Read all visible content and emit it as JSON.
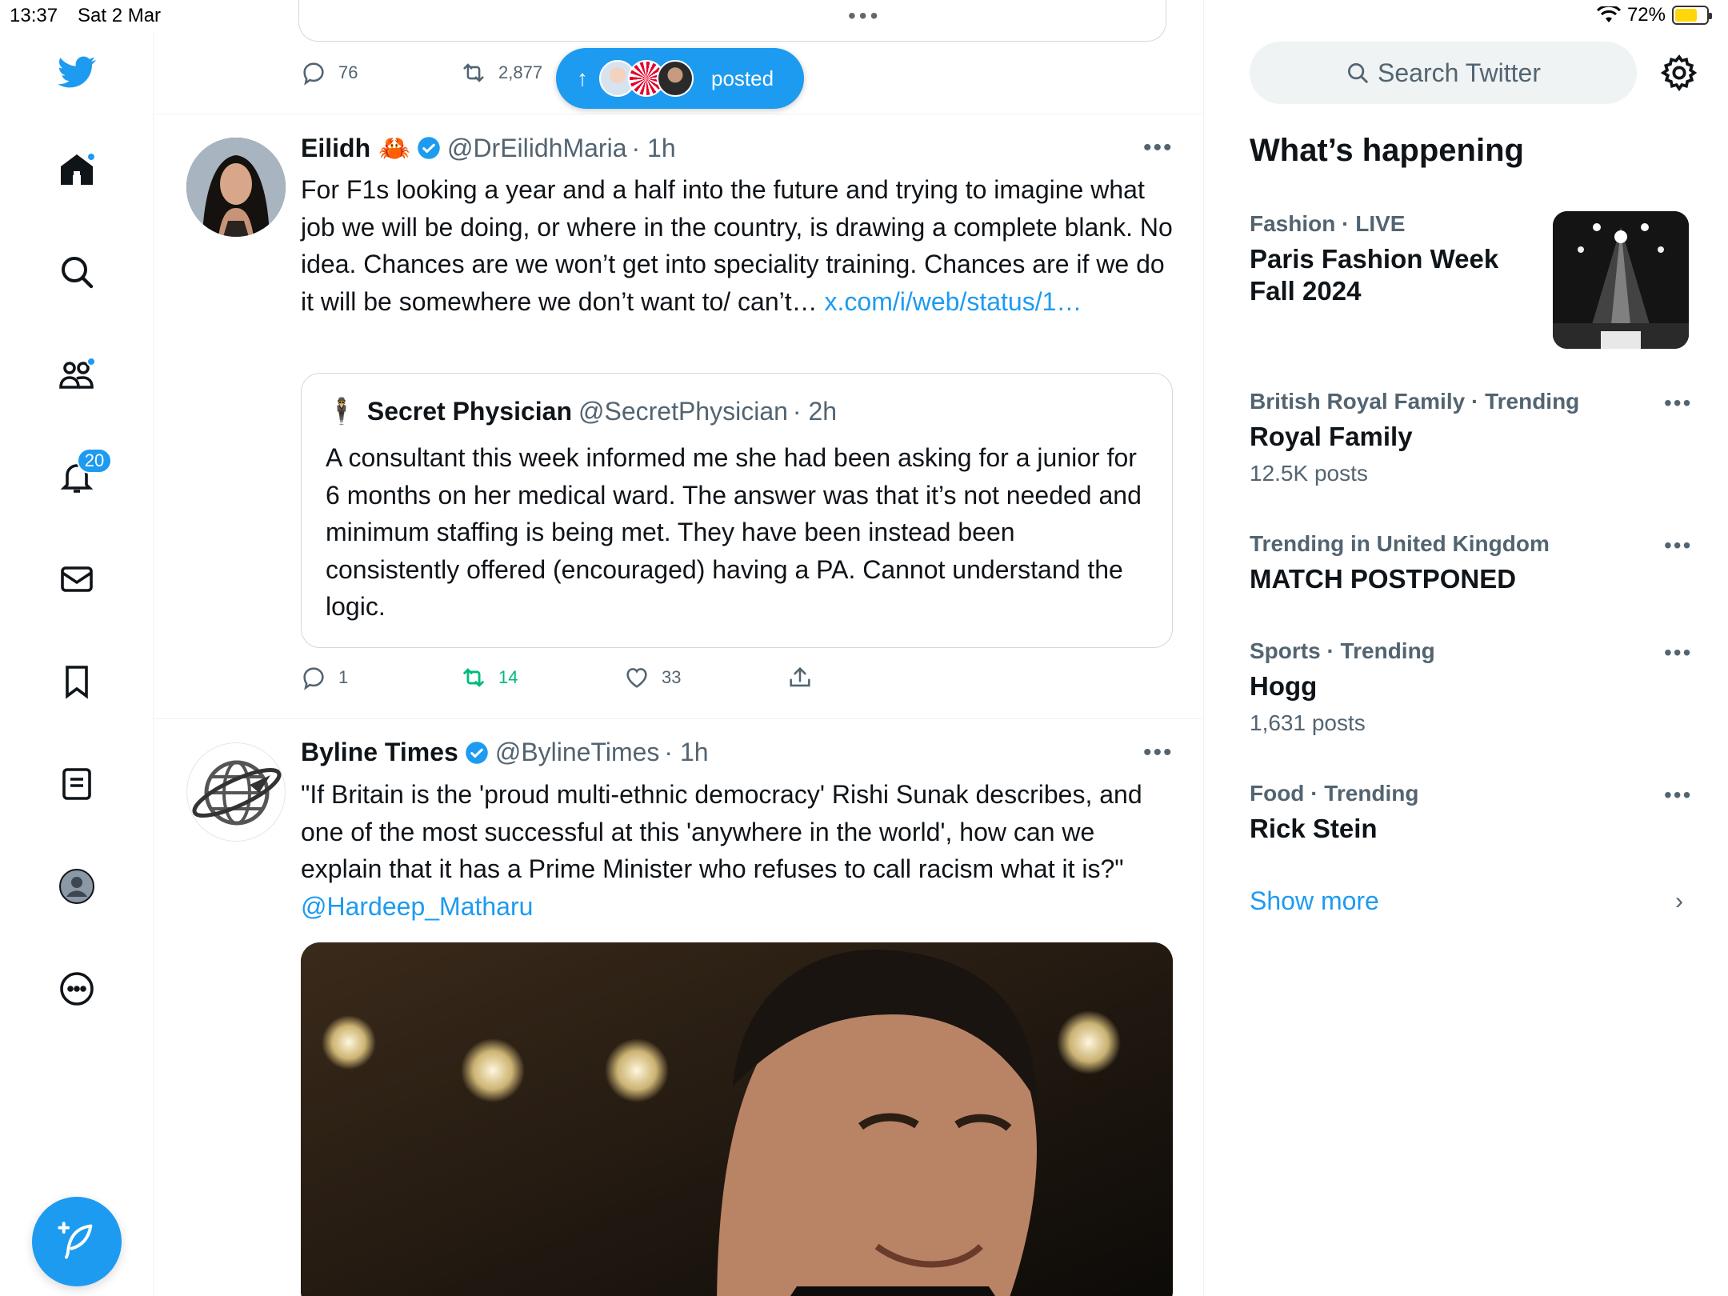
{
  "status_bar": {
    "time": "13:37",
    "date": "Sat 2 Mar",
    "battery": "72%",
    "battery_level": 0.72
  },
  "nav": {
    "items": [
      {
        "name": "logo"
      },
      {
        "name": "home"
      },
      {
        "name": "explore"
      },
      {
        "name": "communities"
      },
      {
        "name": "notifications",
        "badge": "20"
      },
      {
        "name": "messages"
      },
      {
        "name": "bookmarks"
      },
      {
        "name": "lists"
      },
      {
        "name": "profile"
      },
      {
        "name": "more"
      }
    ],
    "notifications_badge": "20"
  },
  "timeline": {
    "top_tweet_actions": {
      "replies": "76",
      "retweets": "2,877"
    },
    "posted_pill": {
      "label": "posted"
    },
    "tweets": [
      {
        "name": "Eilidh",
        "emoji": "🦀",
        "handle": "@DrEilidhMaria",
        "time": "· 1h",
        "text": "For F1s looking a year and a half into the future and trying to imagine what job we will be doing, or where in the country, is drawing a complete blank. No idea. Chances are we won’t get into speciality training. Chances are if we do it will be somewhere we don’t want to/ can’t…",
        "link": "x.com/i/web/status/1…",
        "quote": {
          "emoji": "🕴",
          "name": "Secret Physician",
          "handle": "@SecretPhysician",
          "time": "· 2h",
          "text": "A consultant this week informed me she had been asking for a junior for 6 months on her medical ward. The answer was that it’s not needed and minimum staffing is being met. They have been instead been consistently offered (encouraged) having a PA. Cannot understand the logic."
        },
        "replies": "1",
        "retweets": "14",
        "likes": "33"
      },
      {
        "name": "Byline Times",
        "handle": "@BylineTimes",
        "time": "· 1h",
        "text": "\"If Britain is the 'proud multi-ethnic democracy' Rishi Sunak describes, and one of the most successful at this 'anywhere in the world', how can we explain that it has a Prime Minister who refuses to call racism what it is?\"",
        "mention": "@Hardeep_Matharu"
      }
    ]
  },
  "sidebar": {
    "search_placeholder": "Search Twitter",
    "heading": "What’s happening",
    "trends": [
      {
        "meta": "Fashion · LIVE",
        "title": "Paris Fashion Week Fall 2024",
        "count": ""
      },
      {
        "meta": "British Royal Family · Trending",
        "title": "Royal Family",
        "count": "12.5K posts"
      },
      {
        "meta": "Trending in United Kingdom",
        "title": "MATCH POSTPONED",
        "count": ""
      },
      {
        "meta": "Sports · Trending",
        "title": "Hogg",
        "count": "1,631 posts"
      },
      {
        "meta": "Food · Trending",
        "title": "Rick Stein",
        "count": ""
      }
    ],
    "show_more": "Show more"
  },
  "colors": {
    "accent": "#1d9bf0",
    "retweet_active": "#00ba7c",
    "text": "#0f1419",
    "secondary": "#536471"
  }
}
